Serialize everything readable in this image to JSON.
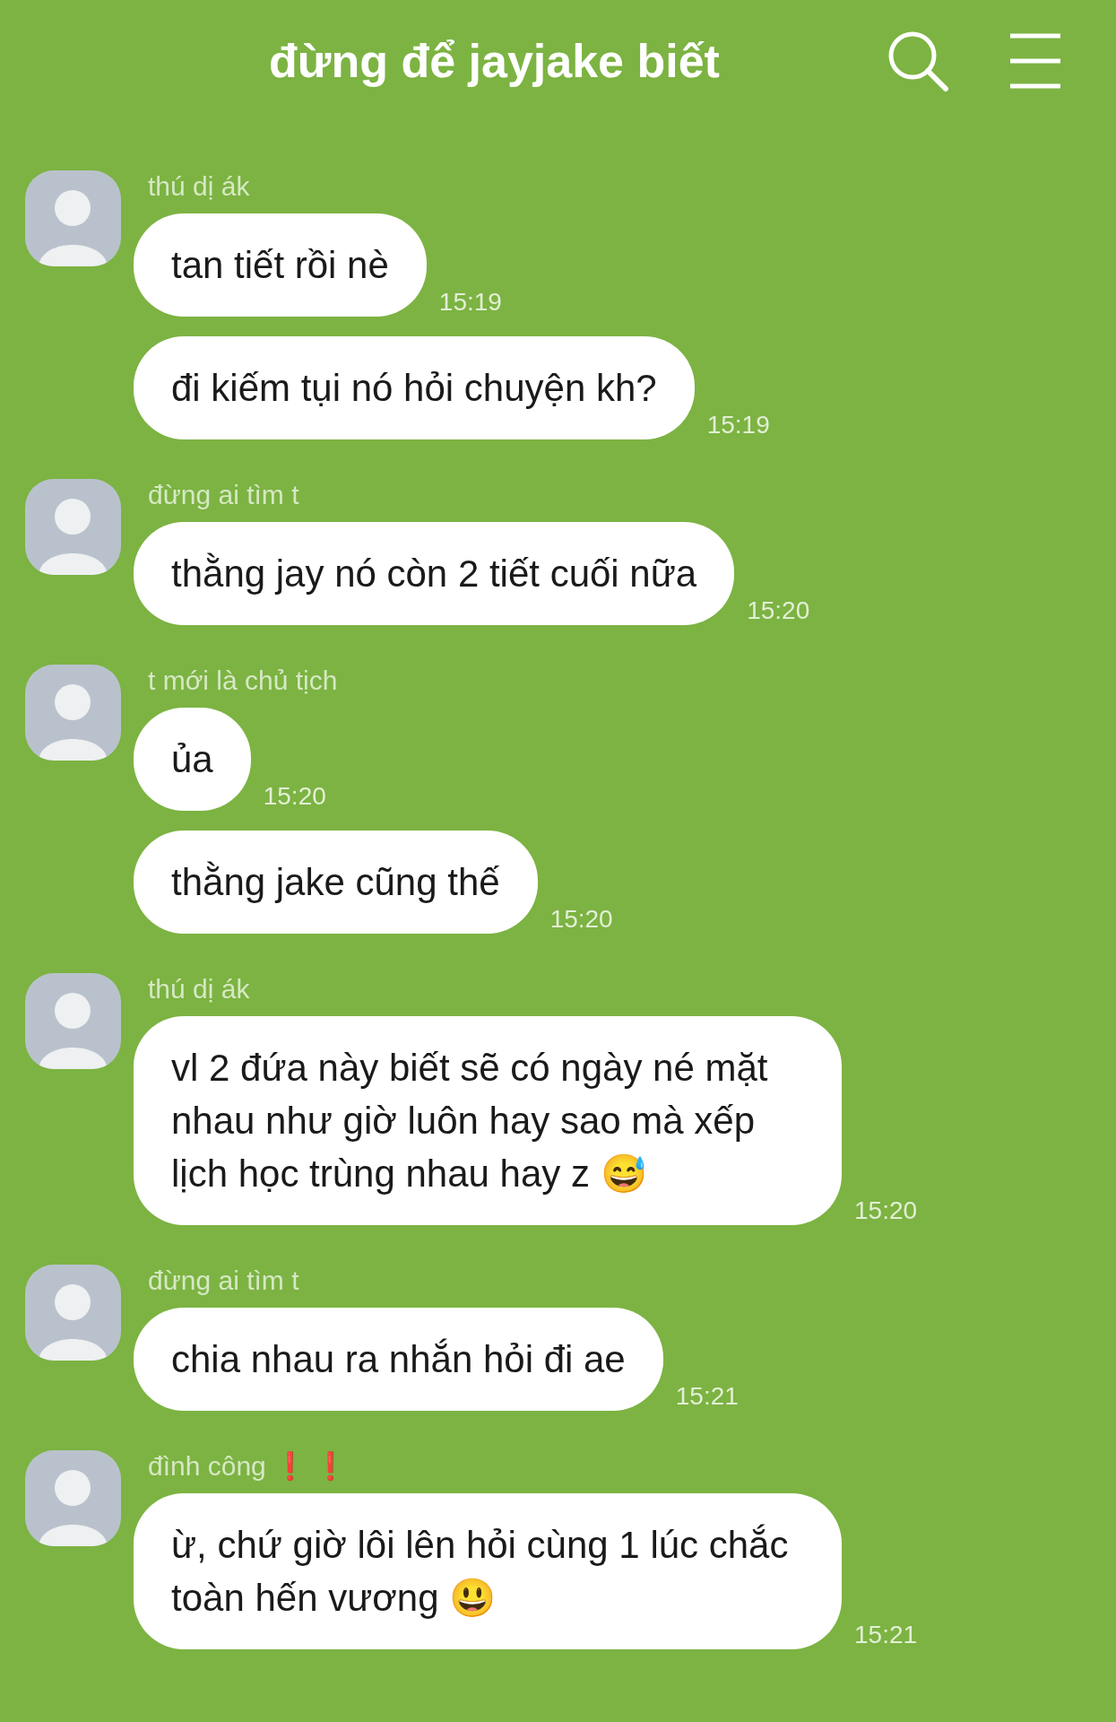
{
  "header": {
    "title": "đừng để jayjake biết"
  },
  "groups": [
    {
      "sender": "thú dị ák",
      "messages": [
        {
          "text": "tan tiết rồi nè",
          "time": "15:19"
        },
        {
          "text": "đi kiếm tụi nó hỏi chuyện kh?",
          "time": "15:19"
        }
      ]
    },
    {
      "sender": "đừng ai tìm t",
      "messages": [
        {
          "text": "thằng jay nó còn 2 tiết cuối nữa",
          "time": "15:20"
        }
      ]
    },
    {
      "sender": "t mới là chủ tịch",
      "messages": [
        {
          "text": "ủa",
          "time": "15:20"
        },
        {
          "text": "thằng jake cũng thế",
          "time": "15:20"
        }
      ]
    },
    {
      "sender": "thú dị ák",
      "messages": [
        {
          "text": "vl 2 đứa này biết sẽ có ngày né mặt nhau như giờ luôn hay sao mà xếp lịch học trùng nhau hay z 😅",
          "time": "15:20"
        }
      ]
    },
    {
      "sender": "đừng ai tìm t",
      "messages": [
        {
          "text": "chia nhau ra nhắn hỏi đi ae",
          "time": "15:21"
        }
      ]
    },
    {
      "sender": "đình công ❗ ❗",
      "messages": [
        {
          "text": "ừ, chứ giờ lôi lên hỏi cùng 1 lúc chắc toàn hến vương 😃",
          "time": "15:21"
        }
      ]
    }
  ]
}
